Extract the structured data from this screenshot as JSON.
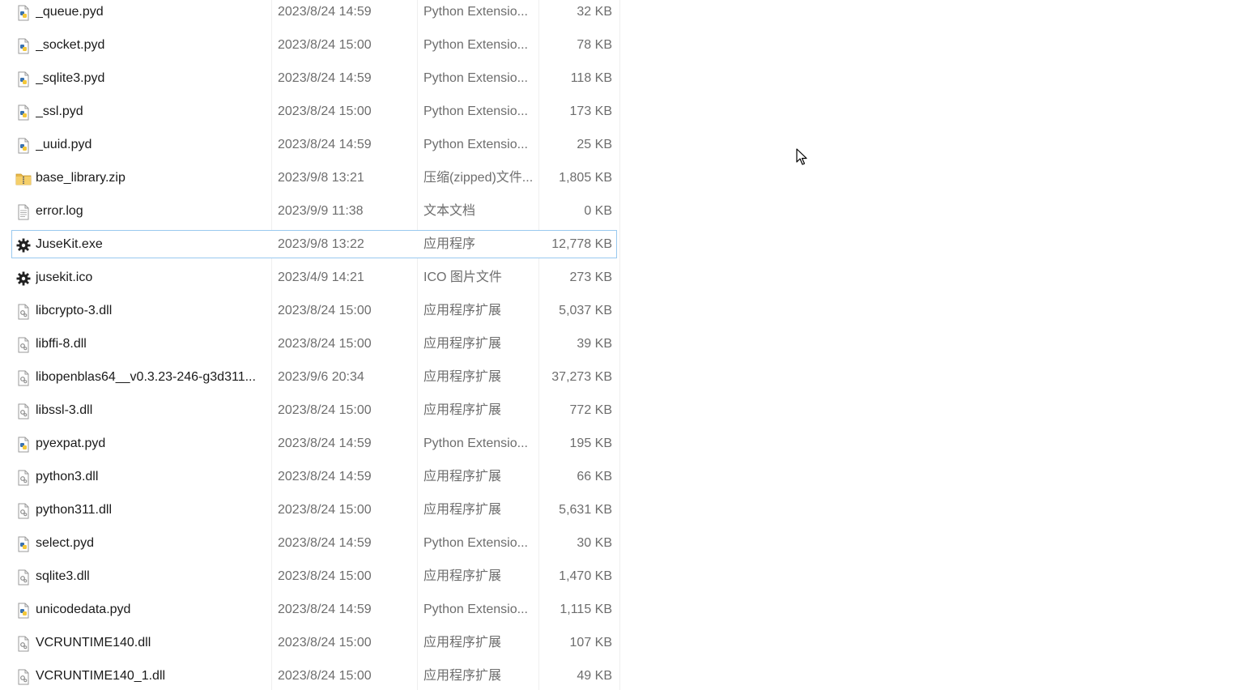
{
  "files": [
    {
      "name": "_queue.pyd",
      "date": "2023/8/24 14:59",
      "type": "Python Extensio...",
      "size": "32 KB",
      "icon": "python-file-icon"
    },
    {
      "name": "_socket.pyd",
      "date": "2023/8/24 15:00",
      "type": "Python Extensio...",
      "size": "78 KB",
      "icon": "python-file-icon"
    },
    {
      "name": "_sqlite3.pyd",
      "date": "2023/8/24 14:59",
      "type": "Python Extensio...",
      "size": "118 KB",
      "icon": "python-file-icon"
    },
    {
      "name": "_ssl.pyd",
      "date": "2023/8/24 15:00",
      "type": "Python Extensio...",
      "size": "173 KB",
      "icon": "python-file-icon"
    },
    {
      "name": "_uuid.pyd",
      "date": "2023/8/24 14:59",
      "type": "Python Extensio...",
      "size": "25 KB",
      "icon": "python-file-icon"
    },
    {
      "name": "base_library.zip",
      "date": "2023/9/8 13:21",
      "type": "压缩(zipped)文件...",
      "size": "1,805 KB",
      "icon": "zip-folder-icon"
    },
    {
      "name": "error.log",
      "date": "2023/9/9 11:38",
      "type": "文本文档",
      "size": "0 KB",
      "icon": "text-file-icon"
    },
    {
      "name": "JuseKit.exe",
      "date": "2023/9/8 13:22",
      "type": "应用程序",
      "size": "12,778 KB",
      "icon": "gear-icon",
      "selected": true
    },
    {
      "name": "jusekit.ico",
      "date": "2023/4/9 14:21",
      "type": "ICO 图片文件",
      "size": "273 KB",
      "icon": "gear-icon"
    },
    {
      "name": "libcrypto-3.dll",
      "date": "2023/8/24 15:00",
      "type": "应用程序扩展",
      "size": "5,037 KB",
      "icon": "dll-file-icon"
    },
    {
      "name": "libffi-8.dll",
      "date": "2023/8/24 15:00",
      "type": "应用程序扩展",
      "size": "39 KB",
      "icon": "dll-file-icon"
    },
    {
      "name": "libopenblas64__v0.3.23-246-g3d311...",
      "date": "2023/9/6 20:34",
      "type": "应用程序扩展",
      "size": "37,273 KB",
      "icon": "dll-file-icon"
    },
    {
      "name": "libssl-3.dll",
      "date": "2023/8/24 15:00",
      "type": "应用程序扩展",
      "size": "772 KB",
      "icon": "dll-file-icon"
    },
    {
      "name": "pyexpat.pyd",
      "date": "2023/8/24 14:59",
      "type": "Python Extensio...",
      "size": "195 KB",
      "icon": "python-file-icon"
    },
    {
      "name": "python3.dll",
      "date": "2023/8/24 14:59",
      "type": "应用程序扩展",
      "size": "66 KB",
      "icon": "dll-file-icon"
    },
    {
      "name": "python311.dll",
      "date": "2023/8/24 15:00",
      "type": "应用程序扩展",
      "size": "5,631 KB",
      "icon": "dll-file-icon"
    },
    {
      "name": "select.pyd",
      "date": "2023/8/24 14:59",
      "type": "Python Extensio...",
      "size": "30 KB",
      "icon": "python-file-icon"
    },
    {
      "name": "sqlite3.dll",
      "date": "2023/8/24 15:00",
      "type": "应用程序扩展",
      "size": "1,470 KB",
      "icon": "dll-file-icon"
    },
    {
      "name": "unicodedata.pyd",
      "date": "2023/8/24 14:59",
      "type": "Python Extensio...",
      "size": "1,115 KB",
      "icon": "python-file-icon"
    },
    {
      "name": "VCRUNTIME140.dll",
      "date": "2023/8/24 15:00",
      "type": "应用程序扩展",
      "size": "107 KB",
      "icon": "dll-file-icon"
    },
    {
      "name": "VCRUNTIME140_1.dll",
      "date": "2023/8/24 15:00",
      "type": "应用程序扩展",
      "size": "49 KB",
      "icon": "dll-file-icon"
    }
  ],
  "colors": {
    "selection_border": "#99c9ef",
    "text": "#1a1a1a",
    "muted_text": "#6d6d6d",
    "python_blue": "#3a72b0",
    "python_yellow": "#f3c73a",
    "zip_yellow": "#e8b84a"
  }
}
